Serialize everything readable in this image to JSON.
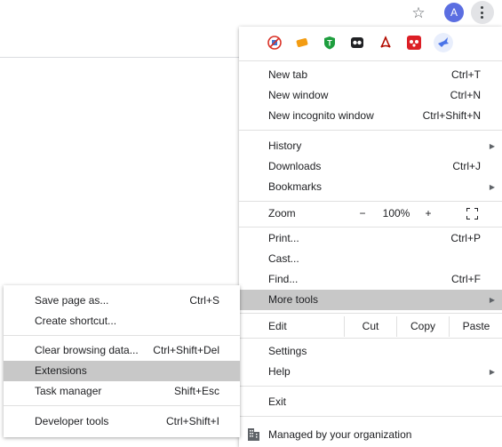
{
  "toolbar": {
    "avatar_letter": "A"
  },
  "extensions": [
    {
      "icon": "no-tracking-icon",
      "color": "#d93025"
    },
    {
      "icon": "honey-icon",
      "color": "#f39c12"
    },
    {
      "icon": "t-shield-icon",
      "color": "#1e9e3e"
    },
    {
      "icon": "owl-icon",
      "color": "#202124"
    },
    {
      "icon": "acrobat-icon",
      "color": "#b30b00"
    },
    {
      "icon": "mendeley-icon",
      "color": "#dc1f26"
    },
    {
      "icon": "bird-icon",
      "color": "#4a74e8"
    }
  ],
  "menu": {
    "new_tab": {
      "label": "New tab",
      "shortcut": "Ctrl+T"
    },
    "new_window": {
      "label": "New window",
      "shortcut": "Ctrl+N"
    },
    "new_incognito": {
      "label": "New incognito window",
      "shortcut": "Ctrl+Shift+N"
    },
    "history": {
      "label": "History"
    },
    "downloads": {
      "label": "Downloads",
      "shortcut": "Ctrl+J"
    },
    "bookmarks": {
      "label": "Bookmarks"
    },
    "zoom": {
      "label": "Zoom",
      "minus": "−",
      "value": "100%",
      "plus": "+"
    },
    "print": {
      "label": "Print...",
      "shortcut": "Ctrl+P"
    },
    "cast": {
      "label": "Cast..."
    },
    "find": {
      "label": "Find...",
      "shortcut": "Ctrl+F"
    },
    "more_tools": {
      "label": "More tools"
    },
    "edit": {
      "label": "Edit",
      "cut": "Cut",
      "copy": "Copy",
      "paste": "Paste"
    },
    "settings": {
      "label": "Settings"
    },
    "help": {
      "label": "Help"
    },
    "exit": {
      "label": "Exit"
    },
    "managed": {
      "label": "Managed by your organization"
    }
  },
  "submenu": {
    "save_page": {
      "label": "Save page as...",
      "shortcut": "Ctrl+S"
    },
    "create_shortcut": {
      "label": "Create shortcut..."
    },
    "clear_browsing": {
      "label": "Clear browsing data...",
      "shortcut": "Ctrl+Shift+Del"
    },
    "extensions": {
      "label": "Extensions"
    },
    "task_manager": {
      "label": "Task manager",
      "shortcut": "Shift+Esc"
    },
    "developer_tools": {
      "label": "Developer tools",
      "shortcut": "Ctrl+Shift+I"
    }
  }
}
